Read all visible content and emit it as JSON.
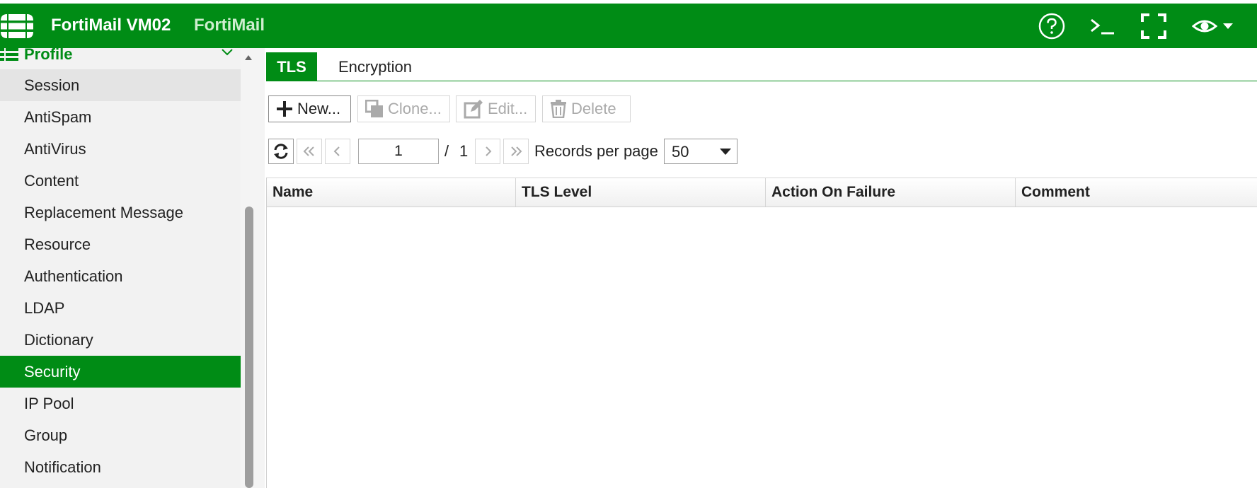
{
  "topbar": {
    "host_name": "FortiMail VM02",
    "app_name": "FortiMail",
    "icons": [
      "fortinet-logo-icon",
      "help-icon",
      "cli-console-icon",
      "fullscreen-icon",
      "view-menu-icon"
    ]
  },
  "sidebar": {
    "section_label": "Profile",
    "items": [
      {
        "label": "Session"
      },
      {
        "label": "AntiSpam"
      },
      {
        "label": "AntiVirus"
      },
      {
        "label": "Content"
      },
      {
        "label": "Replacement Message"
      },
      {
        "label": "Resource"
      },
      {
        "label": "Authentication"
      },
      {
        "label": "LDAP"
      },
      {
        "label": "Dictionary"
      },
      {
        "label": "Security"
      },
      {
        "label": "IP Pool"
      },
      {
        "label": "Group"
      },
      {
        "label": "Notification"
      }
    ],
    "active_item": "Security",
    "hover_item": "Session"
  },
  "tabs": [
    {
      "label": "TLS",
      "active": true
    },
    {
      "label": "Encryption",
      "active": false
    }
  ],
  "toolbar": {
    "new_label": "New...",
    "clone_label": "Clone...",
    "edit_label": "Edit...",
    "delete_label": "Delete"
  },
  "pagination": {
    "current_page": "1",
    "separator": "/",
    "total_pages": "1",
    "records_label": "Records per page",
    "records_per_page": "50"
  },
  "table": {
    "columns": [
      "Name",
      "TLS Level",
      "Action On Failure",
      "Comment"
    ],
    "rows": []
  },
  "colors": {
    "brand_green": "#008c15",
    "sidebar_bg": "#f2f2f2"
  }
}
